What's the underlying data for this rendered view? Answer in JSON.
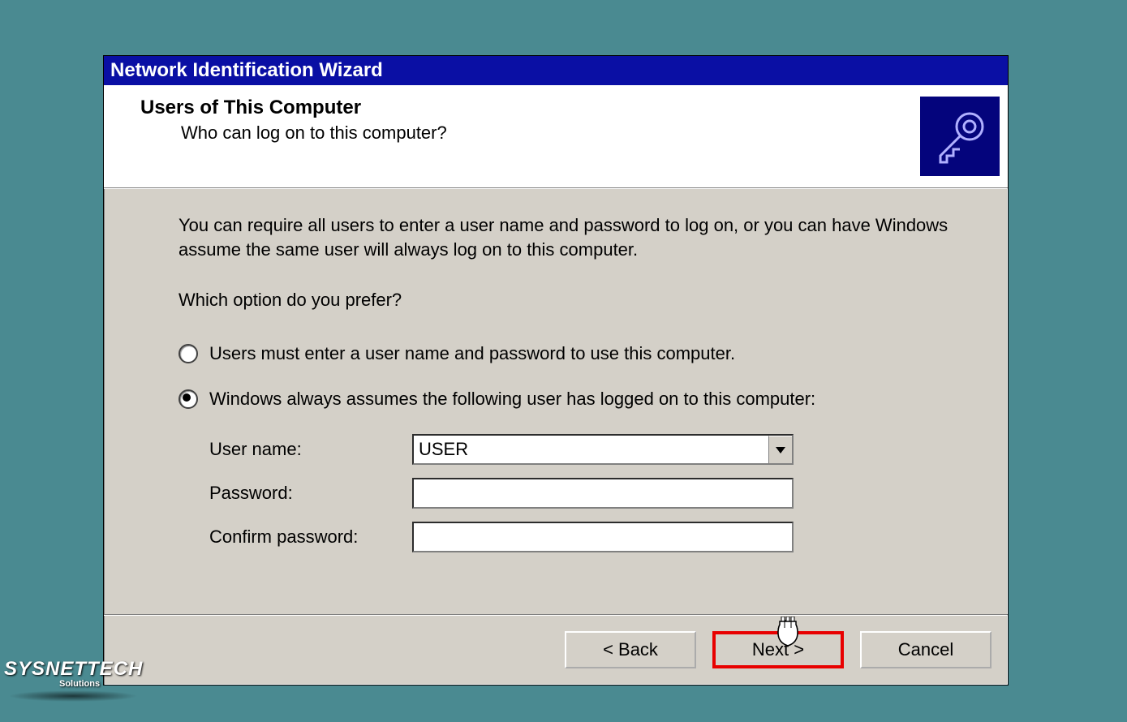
{
  "window": {
    "title": "Network Identification Wizard",
    "header": {
      "heading": "Users of This Computer",
      "subheading": "Who can log on to this computer?"
    },
    "body": {
      "description": "You can require all users to enter a user name and password to log on, or you can have Windows assume the same user will always log on to this computer.",
      "prompt": "Which option do you prefer?",
      "option1": "Users must enter a user name and password to use this computer.",
      "option2": "Windows always assumes the following user has logged on to this computer:",
      "username_label": "User name:",
      "username_value": "USER",
      "password_label": "Password:",
      "password_value": "",
      "confirm_label": "Confirm password:",
      "confirm_value": ""
    },
    "buttons": {
      "back": "< Back",
      "next": "Next >",
      "cancel": "Cancel"
    }
  },
  "watermark": {
    "line1": "SYSNETTECH",
    "line2": "Solutions"
  }
}
